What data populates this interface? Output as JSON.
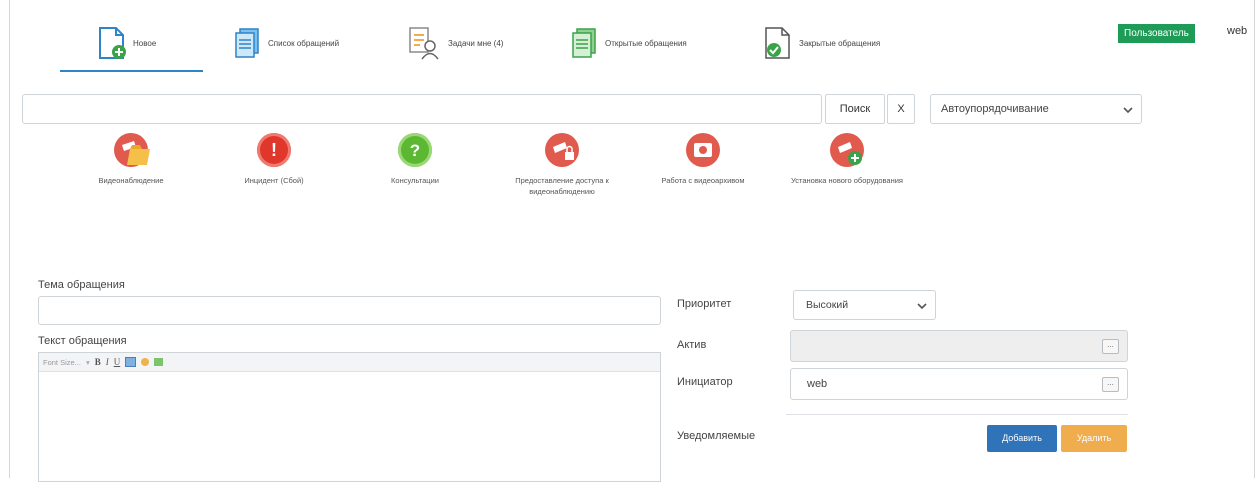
{
  "nav": {
    "tabs": [
      {
        "label": "Новое",
        "icon": "new-doc-icon"
      },
      {
        "label": "Список обращений",
        "icon": "doc-list-icon"
      },
      {
        "label": "Задачи мне (4)",
        "icon": "tasks-icon"
      },
      {
        "label": "Открытые обращения",
        "icon": "open-docs-icon"
      },
      {
        "label": "Закрытые обращения",
        "icon": "closed-doc-icon"
      }
    ],
    "user_button": "Пользователь",
    "username": "web"
  },
  "search": {
    "value": "",
    "button": "Поиск",
    "clear": "X",
    "sort_selected": "Автоупорядочивание"
  },
  "categories": [
    {
      "label": "Видеонаблюдение",
      "icon": "camera-folder-icon",
      "color": "#e05a4e"
    },
    {
      "label": "Инцидент (Сбой)",
      "icon": "exclamation-icon",
      "color": "#e0372c"
    },
    {
      "label": "Консультации",
      "icon": "question-icon",
      "color": "#5cb832"
    },
    {
      "label": "Предоставление доступа к видеонаблюдению",
      "icon": "camera-access-icon",
      "color": "#e05a4e"
    },
    {
      "label": "Работа с видеоархивом",
      "icon": "video-archive-icon",
      "color": "#e05a4e"
    },
    {
      "label": "Установка нового оборудования",
      "icon": "camera-add-icon",
      "color": "#e05a4e"
    }
  ],
  "form": {
    "theme_label": "Тема обращения",
    "theme_value": "",
    "text_label": "Текст обращения",
    "font_size_placeholder": "Font Size...",
    "toolbar": {
      "bold": "B",
      "italic": "I",
      "underline": "U"
    },
    "priority_label": "Приоритет",
    "priority_value": "Высокий",
    "asset_label": "Актив",
    "asset_value": "",
    "initiator_label": "Инициатор",
    "initiator_value": "web",
    "notified_label": "Уведомляемые",
    "add_button": "Добавить",
    "delete_button": "Удалить",
    "dots": "..."
  },
  "colors": {
    "accent": "#2c84c9",
    "user_badge": "#1e9b57",
    "add": "#2f73b8",
    "delete": "#f0ad4e"
  }
}
